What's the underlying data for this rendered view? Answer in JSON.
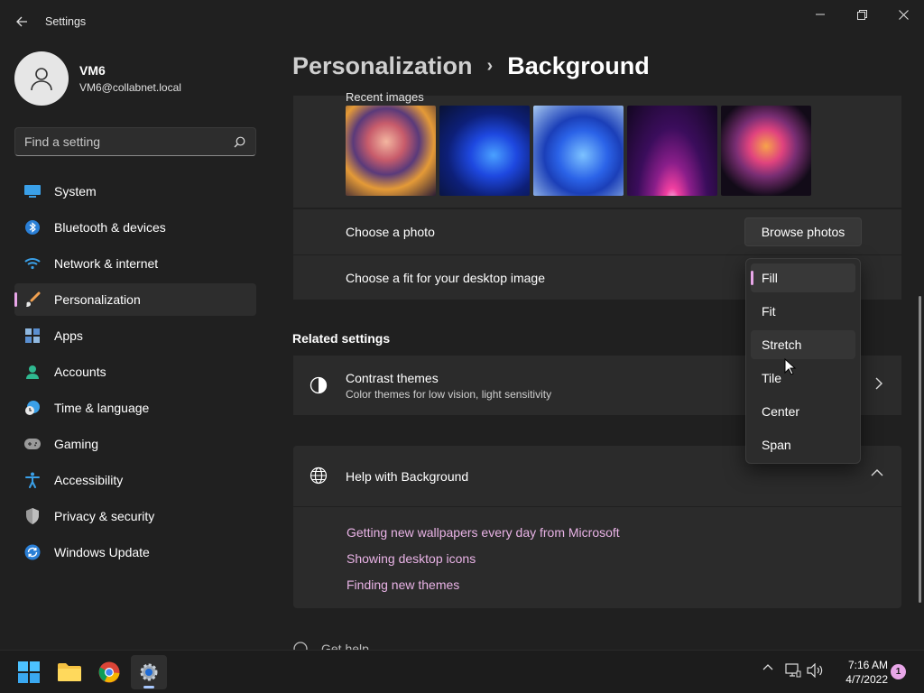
{
  "window": {
    "title": "Settings"
  },
  "profile": {
    "name": "VM6",
    "email": "VM6@collabnet.local"
  },
  "search": {
    "placeholder": "Find a setting"
  },
  "nav": {
    "items": [
      {
        "label": "System",
        "icon": "system-icon"
      },
      {
        "label": "Bluetooth & devices",
        "icon": "bluetooth-icon"
      },
      {
        "label": "Network & internet",
        "icon": "wifi-icon"
      },
      {
        "label": "Personalization",
        "icon": "brush-icon",
        "selected": true
      },
      {
        "label": "Apps",
        "icon": "apps-icon"
      },
      {
        "label": "Accounts",
        "icon": "accounts-icon"
      },
      {
        "label": "Time & language",
        "icon": "clock-globe-icon"
      },
      {
        "label": "Gaming",
        "icon": "gamepad-icon"
      },
      {
        "label": "Accessibility",
        "icon": "accessibility-icon"
      },
      {
        "label": "Privacy & security",
        "icon": "shield-icon"
      },
      {
        "label": "Windows Update",
        "icon": "update-icon"
      }
    ]
  },
  "breadcrumb": {
    "parent": "Personalization",
    "separator": "›",
    "current": "Background"
  },
  "background": {
    "recent_images_label": "Recent images",
    "choose_photo_label": "Choose a photo",
    "browse_button": "Browse photos",
    "fit_label": "Choose a fit for your desktop image"
  },
  "fit_dropdown": {
    "options": [
      "Fill",
      "Fit",
      "Stretch",
      "Tile",
      "Center",
      "Span"
    ],
    "selected": "Fill",
    "hovered": "Stretch"
  },
  "related": {
    "title": "Related settings",
    "contrast_title": "Contrast themes",
    "contrast_subtitle": "Color themes for low vision, light sensitivity"
  },
  "help": {
    "title": "Help with Background",
    "links": [
      "Getting new wallpapers every day from Microsoft",
      "Showing desktop icons",
      "Finding new themes"
    ],
    "get_help": "Get help"
  },
  "taskbar": {
    "time": "7:16 AM",
    "date": "4/7/2022",
    "notification_count": "1"
  },
  "colors": {
    "accent": "#e8a6e8",
    "background": "#202020",
    "card": "#2b2b2b"
  }
}
